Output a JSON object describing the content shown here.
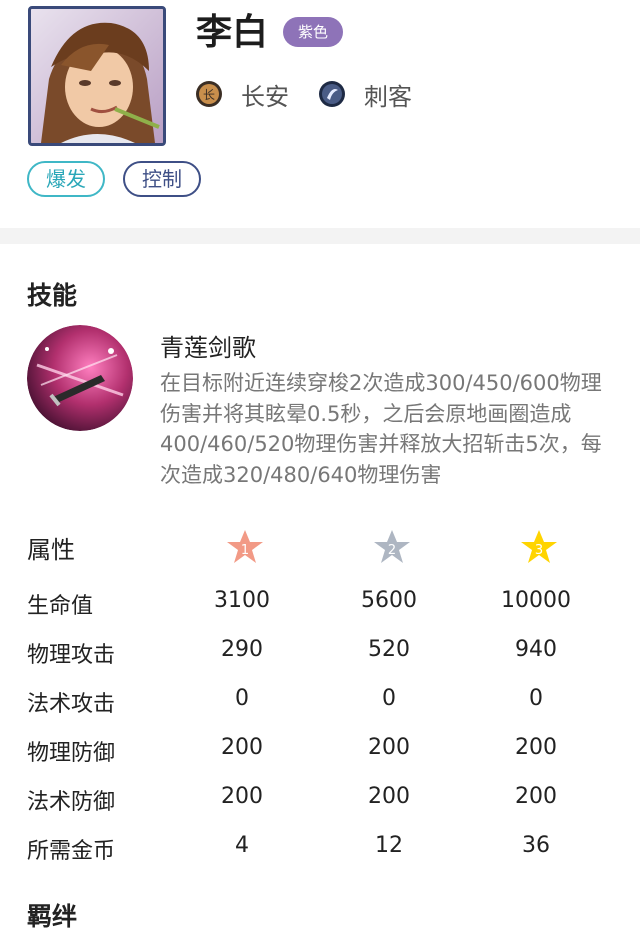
{
  "hero": {
    "name": "李白",
    "tier": "紫色",
    "synergies": [
      {
        "name": "长安",
        "icon": "changan-emblem-icon"
      },
      {
        "name": "刺客",
        "icon": "assassin-emblem-icon"
      }
    ],
    "tags": [
      "爆发",
      "控制"
    ]
  },
  "skill_section": {
    "title": "技能",
    "skill_name": "青莲剑歌",
    "skill_description": "在目标附近连续穿梭2次造成300/450/600物理伤害并将其眩晕0.5秒，之后会原地画圈造成400/460/520物理伤害并释放大招斩击5次，每次造成320/480/640物理伤害"
  },
  "attributes": {
    "title": "属性",
    "star_levels": [
      "1",
      "2",
      "3"
    ],
    "rows": [
      {
        "label": "生命值",
        "values": [
          "3100",
          "5600",
          "10000"
        ]
      },
      {
        "label": "物理攻击",
        "values": [
          "290",
          "520",
          "940"
        ]
      },
      {
        "label": "法术攻击",
        "values": [
          "0",
          "0",
          "0"
        ]
      },
      {
        "label": "物理防御",
        "values": [
          "200",
          "200",
          "200"
        ]
      },
      {
        "label": "法术防御",
        "values": [
          "200",
          "200",
          "200"
        ]
      },
      {
        "label": "所需金币",
        "values": [
          "4",
          "12",
          "36"
        ]
      }
    ]
  },
  "next_section": {
    "title": "羁绊"
  },
  "colors": {
    "tier_badge": "#8e73b8",
    "tag_burst": "#2aa7b8",
    "tag_control": "#3e4f86",
    "star_bronze": "#f29a86",
    "star_silver": "#aeb6c2",
    "star_gold": "#ffd400"
  }
}
